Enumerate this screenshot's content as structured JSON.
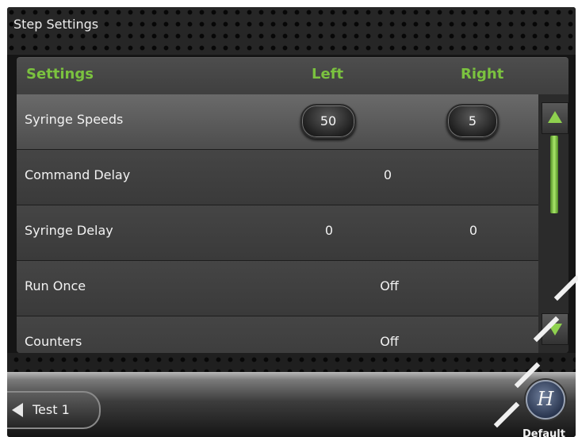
{
  "title": "Step Settings",
  "header": {
    "settings": "Settings",
    "left": "Left",
    "right": "Right"
  },
  "rows": [
    {
      "label": "Syringe Speeds",
      "left": "50",
      "right": "5"
    },
    {
      "label": "Command Delay",
      "value": "0"
    },
    {
      "label": "Syringe Delay",
      "left": "0",
      "right": "0"
    },
    {
      "label": "Run Once",
      "value": "Off"
    },
    {
      "label": "Counters",
      "value": "Off"
    }
  ],
  "footer": {
    "back_label": "Test 1",
    "logo_glyph": "H",
    "default_label": "Default"
  },
  "colors": {
    "accent": "#7bc23f",
    "scroll_accent": "#8fd14f"
  },
  "icons": {
    "scroll_up": "triangle-up-icon",
    "scroll_down": "triangle-down-icon",
    "back": "triangle-left-icon",
    "logo": "hamilton-logo-icon"
  }
}
